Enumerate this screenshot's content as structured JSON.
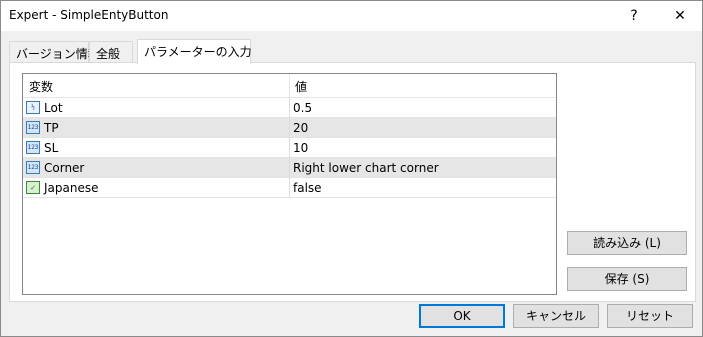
{
  "window": {
    "title": "Expert - SimpleEntyButton",
    "help_label": "?",
    "close_label": "✕"
  },
  "tabs": [
    {
      "label": "バージョン情報",
      "active": false
    },
    {
      "label": "全般",
      "active": false
    },
    {
      "label": "パラメーターの入力",
      "active": true
    }
  ],
  "grid": {
    "col_variable": "変数",
    "col_value": "値",
    "rows": [
      {
        "icon": "fraction-type-icon",
        "icon_text": "½",
        "name": "Lot",
        "value": "0.5"
      },
      {
        "icon": "integer-type-icon",
        "icon_text": "123",
        "name": "TP",
        "value": "20"
      },
      {
        "icon": "integer-type-icon",
        "icon_text": "123",
        "name": "SL",
        "value": "10"
      },
      {
        "icon": "integer-type-icon",
        "icon_text": "123",
        "name": "Corner",
        "value": "Right lower chart corner"
      },
      {
        "icon": "boolean-type-icon",
        "icon_text": "✓",
        "name": "Japanese",
        "value": "false"
      }
    ]
  },
  "side_buttons": {
    "load_label": "読み込み (L)",
    "save_label": "保存 (S)"
  },
  "footer": {
    "ok_label": "OK",
    "cancel_label": "キャンセル",
    "reset_label": "リセット"
  }
}
